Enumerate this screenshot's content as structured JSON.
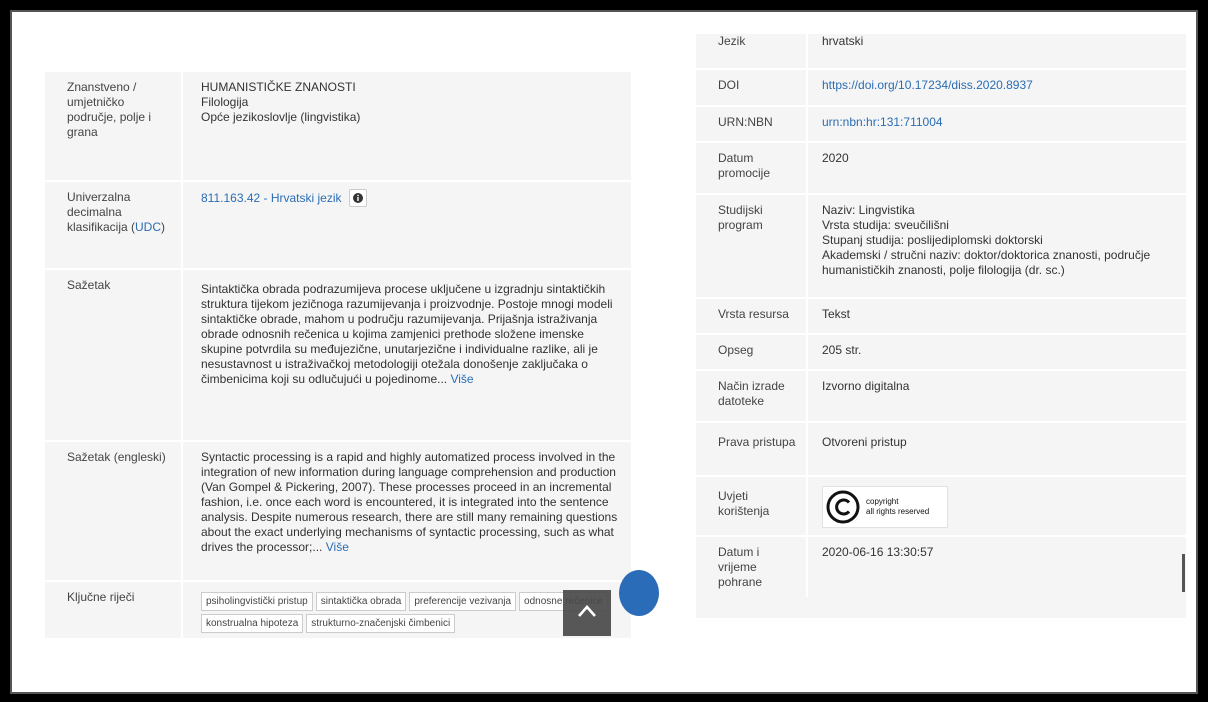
{
  "left": {
    "rows": [
      {
        "label": "Znanstveno / umjetničko područje, polje i grana",
        "lines": [
          "HUMANISTIČKE ZNANOSTI",
          "Filologija",
          "Opće jezikoslovlje (lingvistika)"
        ]
      },
      {
        "label_main": "Univerzalna decimalna klasifikacija (",
        "label_link": "UDC",
        "label_end": ")",
        "link": "811.163.42 - Hrvatski jezik"
      },
      {
        "label": "Sažetak",
        "text": "Sintaktička obrada podrazumijeva procese uključene u izgradnju sintaktičkih struktura tijekom jezičnoga razumijevanja i proizvodnje. Postoje mnogi modeli sintaktičke obrade, mahom u području razumijevanja. Prijašnja istraživanja obrade odnosnih rečenica u kojima zamjenici prethode složene imenske skupine potvrdila su međujezične, unutarjezične i individualne razlike, ali je nesustavnost u istraživačkoj metodologiji otežala donošenje zaključaka o čimbenicima koji su odlučujući u pojedinome...",
        "more": "Više"
      },
      {
        "label": "Sažetak (engleski)",
        "text": "Syntactic processing is a rapid and highly automatized process involved in the integration of new information during language comprehension and production (Van Gompel & Pickering, 2007). These processes proceed in an incremental fashion, i.e. once each word is encountered, it is integrated into the sentence analysis. Despite numerous research, there are still many remaining questions about the exact underlying mechanisms of syntactic processing, such as what drives the processor;...",
        "more": "Više"
      },
      {
        "label": "Ključne riječi",
        "keywords": [
          "psiholingvistički pristup",
          "sintaktička obrada",
          "preferencije vezivanja",
          "odnosne rečenice",
          "konstrualna hipoteza",
          "strukturno-značenjski čimbenici"
        ]
      }
    ]
  },
  "right": {
    "rows": [
      {
        "label": "Jezik",
        "value": "hrvatski"
      },
      {
        "label": "DOI",
        "link": "https://doi.org/10.17234/diss.2020.8937"
      },
      {
        "label": "URN:NBN",
        "link": "urn:nbn:hr:131:711004"
      },
      {
        "label": "Datum promocije",
        "value": "2020"
      },
      {
        "label": "Studijski program",
        "lines": [
          "Naziv: Lingvistika",
          "Vrsta studija: sveučilišni",
          "Stupanj studija: poslijediplomski doktorski",
          "Akademski / stručni naziv: doktor/doktorica znanosti, područje humanističkih znanosti, polje filologija (dr. sc.)"
        ]
      },
      {
        "label": "Vrsta resursa",
        "value": "Tekst"
      },
      {
        "label": "Opseg",
        "value": "205 str."
      },
      {
        "label": "Način izrade datoteke",
        "value": "Izvorno digitalna"
      },
      {
        "label": "Prava pristupa",
        "value": "Otvoreni pristup"
      },
      {
        "label": "Uvjeti korištenja",
        "badge_line1": "copyright",
        "badge_line2": "all rights reserved"
      },
      {
        "label": "Datum i vrijeme pohrane",
        "value": "2020-06-16 13:30:57"
      }
    ]
  },
  "icons": {
    "info": "info-icon",
    "scroll_top": "chevron-up-icon",
    "copyright": "copyright-icon"
  },
  "colors": {
    "link": "#2a6db5",
    "panel_bg": "#f5f5f5",
    "scroll_btn": "#4a4a4a",
    "side_circle": "#2b6cb8"
  }
}
